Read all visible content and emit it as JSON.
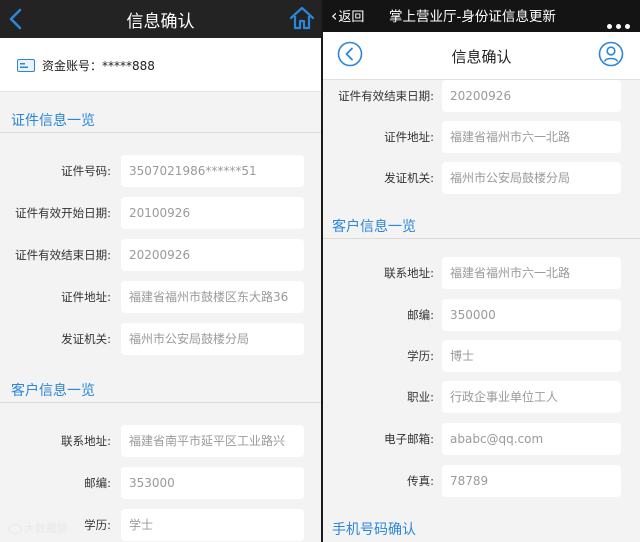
{
  "left": {
    "title": "信息确认",
    "account": {
      "label": "资金账号：",
      "value": "*****888"
    },
    "cert_section": "证件信息一览",
    "cert_rows": [
      {
        "label": "证件号码:",
        "value": "3507021986******51"
      },
      {
        "label": "证件有效开始日期:",
        "value": "20100926"
      },
      {
        "label": "证件有效结束日期:",
        "value": "20200926"
      },
      {
        "label": "证件地址:",
        "value": "福建省福州市鼓楼区东大路36"
      },
      {
        "label": "发证机关:",
        "value": "福州市公安局鼓楼分局"
      }
    ],
    "client_section": "客户信息一览",
    "client_rows": [
      {
        "label": "联系地址:",
        "value": "福建省南平市延平区工业路兴"
      },
      {
        "label": "邮编:",
        "value": "353000"
      },
      {
        "label": "学历:",
        "value": "学士"
      }
    ]
  },
  "right": {
    "status": {
      "back_label": "返回",
      "app_title": "掌上营业厅-身份证信息更新"
    },
    "title": "信息确认",
    "cert_rows": [
      {
        "label": "证件有效结束日期:",
        "value": "20200926"
      },
      {
        "label": "证件地址:",
        "value": "福建省福州市六一北路"
      },
      {
        "label": "发证机关:",
        "value": "福州市公安局鼓楼分局"
      }
    ],
    "client_section": "客户信息一览",
    "client_rows": [
      {
        "label": "联系地址:",
        "value": "福建省福州市六一北路"
      },
      {
        "label": "邮编:",
        "value": "350000"
      },
      {
        "label": "学历:",
        "value": "博士"
      },
      {
        "label": "职业:",
        "value": "行政企事业单位工人"
      },
      {
        "label": "电子邮箱:",
        "value": "ababc@qq.com"
      },
      {
        "label": "传真:",
        "value": "78789"
      }
    ],
    "phone_section": "手机号码确认"
  },
  "watermark": "大数据猿",
  "colors": {
    "accent": "#2b86d9",
    "dark_header": "#232323",
    "background": "#f3f3f3"
  },
  "icons": [
    "back-arrow-icon",
    "home-icon",
    "card-icon",
    "circle-back-icon",
    "user-icon",
    "more-dots-icon"
  ]
}
